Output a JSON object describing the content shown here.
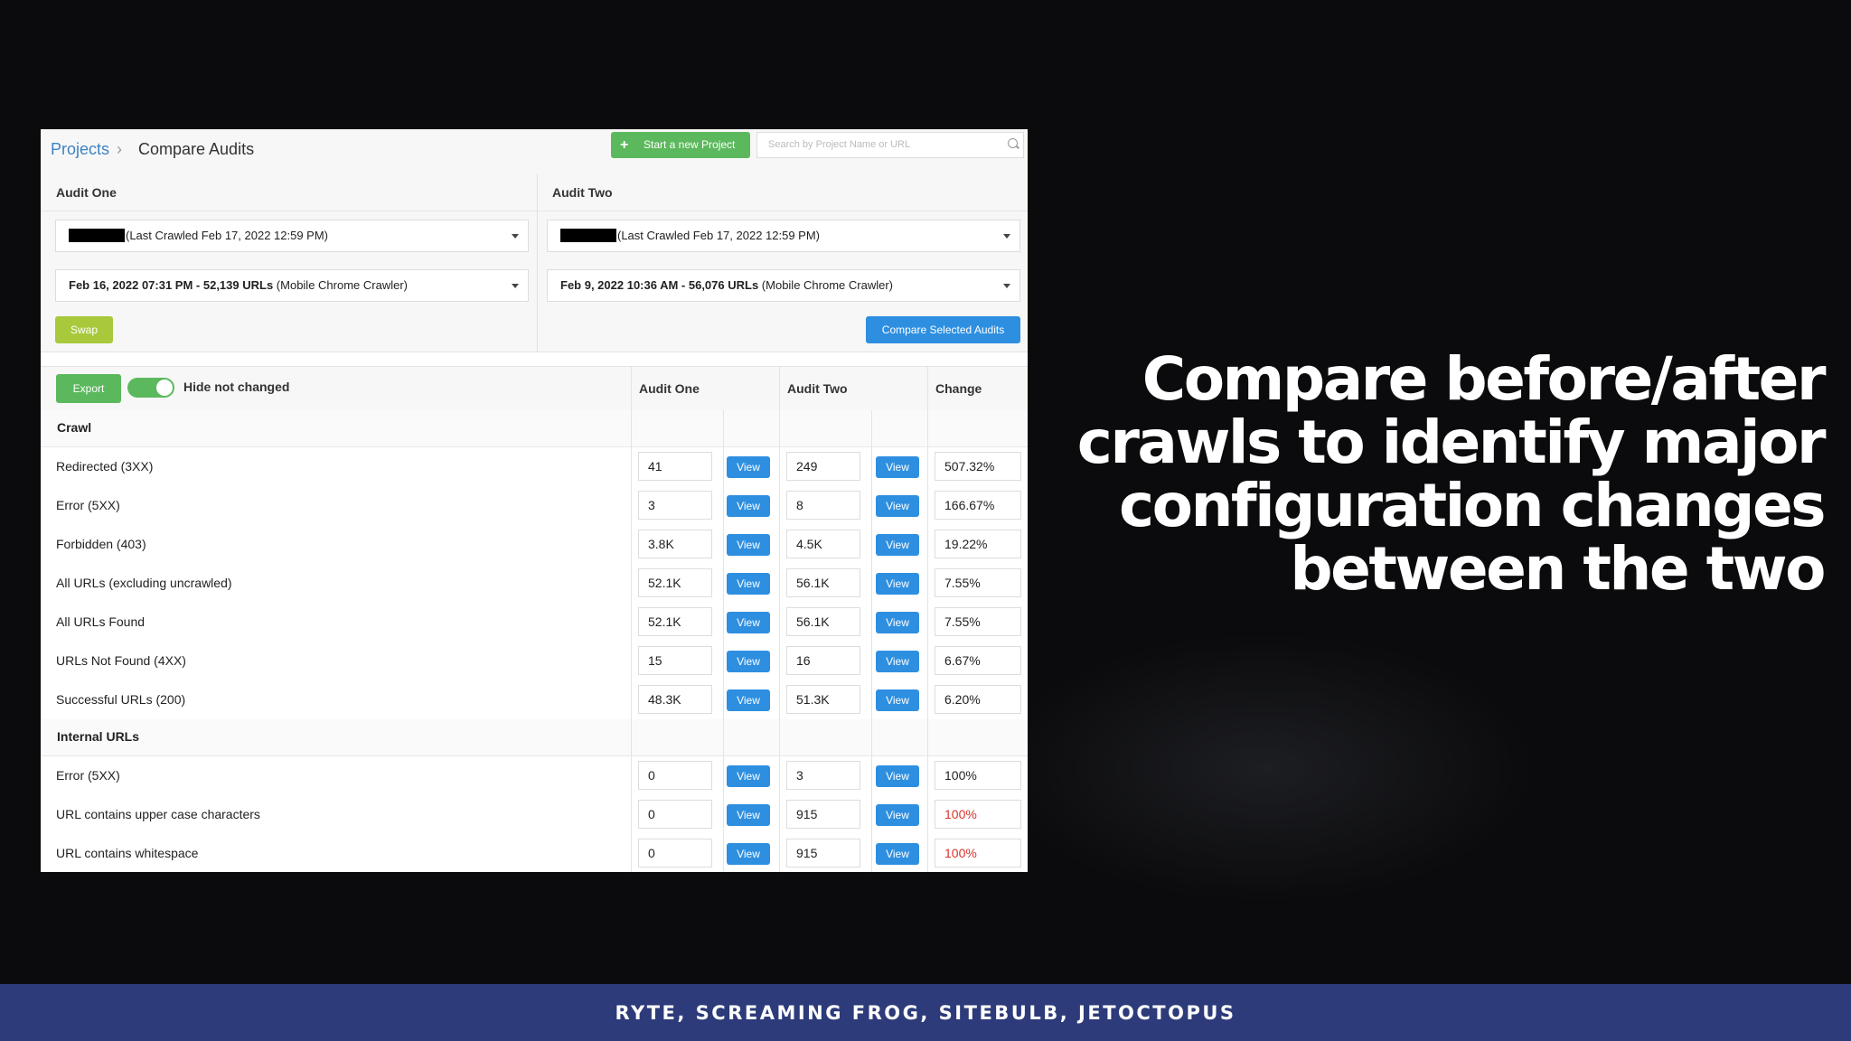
{
  "breadcrumb": {
    "projects": "Projects",
    "separator": "›",
    "current": "Compare Audits"
  },
  "toolbar": {
    "new_project_icon": "+",
    "new_project_label": "Start a new Project",
    "search_placeholder": "Search by Project Name or URL"
  },
  "audit_one": {
    "header": "Audit One",
    "project_select": "(Last Crawled Feb 17, 2022 12:59 PM)",
    "crawl_select_bold": "Feb 16, 2022 07:31 PM - 52,139 URLs",
    "crawl_select_rest": " (Mobile Chrome Crawler)"
  },
  "audit_two": {
    "header": "Audit Two",
    "project_select": "(Last Crawled Feb 17, 2022 12:59 PM)",
    "crawl_select_bold": "Feb 9, 2022 10:36 AM - 56,076 URLs",
    "crawl_select_rest": " (Mobile Chrome Crawler)"
  },
  "buttons": {
    "swap": "Swap",
    "compare": "Compare Selected Audits",
    "export": "Export",
    "view": "View"
  },
  "toggle": {
    "label": "Hide not changed",
    "on": true
  },
  "table_header": {
    "audit_one": "Audit One",
    "audit_two": "Audit Two",
    "change": "Change"
  },
  "sections": [
    {
      "title": "Crawl",
      "rows": [
        {
          "label": "Redirected (3XX)",
          "a": "41",
          "b": "249",
          "change": "507.32%",
          "red": false
        },
        {
          "label": "Error (5XX)",
          "a": "3",
          "b": "8",
          "change": "166.67%",
          "red": false
        },
        {
          "label": "Forbidden (403)",
          "a": "3.8K",
          "b": "4.5K",
          "change": "19.22%",
          "red": false
        },
        {
          "label": "All URLs (excluding uncrawled)",
          "a": "52.1K",
          "b": "56.1K",
          "change": "7.55%",
          "red": false
        },
        {
          "label": "All URLs Found",
          "a": "52.1K",
          "b": "56.1K",
          "change": "7.55%",
          "red": false
        },
        {
          "label": "URLs Not Found (4XX)",
          "a": "15",
          "b": "16",
          "change": "6.67%",
          "red": false
        },
        {
          "label": "Successful URLs (200)",
          "a": "48.3K",
          "b": "51.3K",
          "change": "6.20%",
          "red": false
        }
      ]
    },
    {
      "title": "Internal URLs",
      "rows": [
        {
          "label": "Error (5XX)",
          "a": "0",
          "b": "3",
          "change": "100%",
          "red": false
        },
        {
          "label": "URL contains upper case characters",
          "a": "0",
          "b": "915",
          "change": "100%",
          "red": true
        },
        {
          "label": "URL contains whitespace",
          "a": "0",
          "b": "915",
          "change": "100%",
          "red": true
        }
      ]
    }
  ],
  "slide": {
    "headline": [
      "Compare before/after",
      "crawls to identify major",
      "configuration changes",
      "between the two"
    ],
    "footer": "RYTE, SCREAMING FROG, SITEBULB, JETOCTOPUS"
  },
  "colors": {
    "accent_blue": "#2e8fe0",
    "green": "#5cb85c",
    "swap": "#a8c93b",
    "red": "#d9342b",
    "footer": "#2d3b7a"
  }
}
